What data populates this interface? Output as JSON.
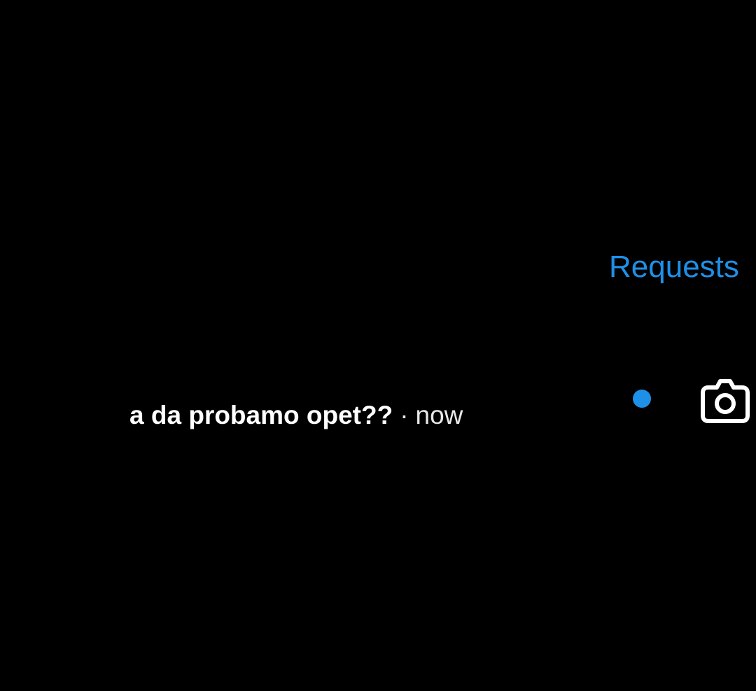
{
  "header": {
    "requests_label": "Requests"
  },
  "thread": {
    "message_preview": "a da probamo opet??",
    "separator": "·",
    "timestamp": "now",
    "unread": true,
    "action_icon": "camera-icon"
  },
  "colors": {
    "background": "#000000",
    "accent": "#1E90E8",
    "text": "#ffffff"
  }
}
